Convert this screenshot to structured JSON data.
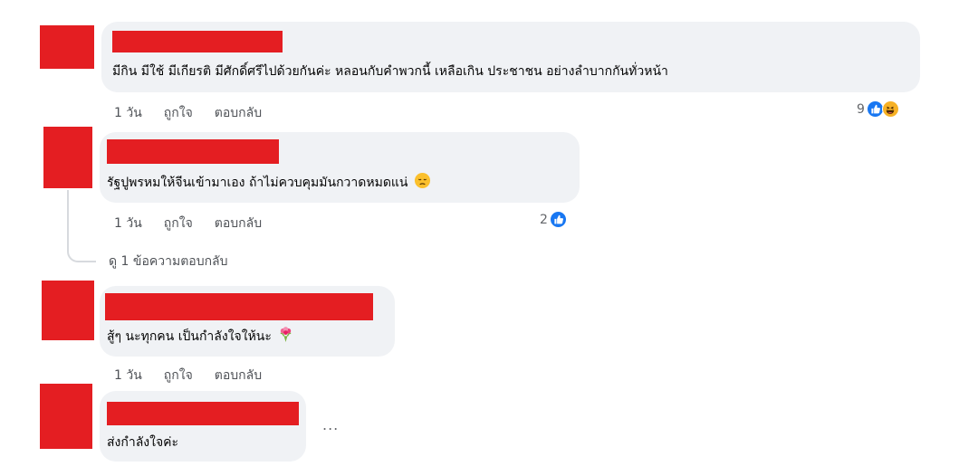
{
  "comments": [
    {
      "text": "มีกิน มีใช้ มีเกียรติ มีศักดิ์ศรีไปด้วยกันค่ะ หลอนกับคำพวกนี้ เหลือเกิน ประชาชน อย่างลำบากกันทั่วหน้า",
      "time": "1 วัน",
      "like": "ถูกใจ",
      "reply": "ตอบกลับ",
      "reaction_count": "9",
      "reactions": [
        "like-icon",
        "haha-icon"
      ]
    },
    {
      "text": "รัฐปูพรหมให้จีนเข้ามาเอง ถ้าไม่ควบคุมมันกวาดหมดแน่",
      "emoji": "disappointed-face-icon",
      "time": "1 วัน",
      "like": "ถูกใจ",
      "reply": "ตอบกลับ",
      "reaction_count": "2",
      "reactions": [
        "like-icon"
      ]
    },
    {
      "text": "สู้ๆ นะทุกคน เป็นกำลังใจให้นะ",
      "emoji": "bouquet-icon",
      "time": "1 วัน",
      "like": "ถูกใจ",
      "reply": "ตอบกลับ"
    },
    {
      "text": "ส่งกำลังใจค่ะ",
      "more": "..."
    }
  ],
  "view_replies": "ดู 1 ข้อความตอบกลับ",
  "colors": {
    "redaction": "#e41e22",
    "bubble": "#f0f2f5",
    "like_blue": "#1877f2",
    "haha_yellow": "#f7b125"
  }
}
